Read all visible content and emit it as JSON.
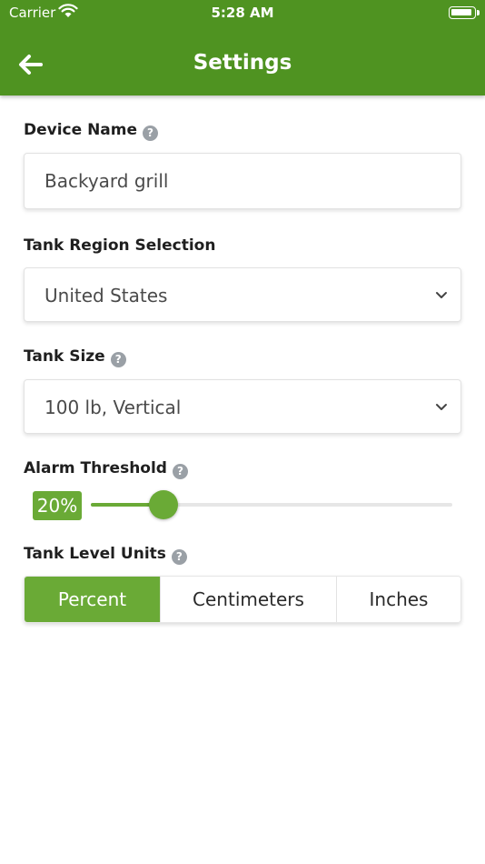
{
  "status_bar": {
    "carrier": "Carrier",
    "time": "5:28 AM"
  },
  "header": {
    "title": "Settings",
    "back_icon": "arrow-left-icon"
  },
  "colors": {
    "header": "#4f9321",
    "accent": "#6aaa36",
    "help_icon": "#9aa0a6"
  },
  "device_name": {
    "label": "Device Name",
    "value": "Backyard grill"
  },
  "tank_region": {
    "label": "Tank Region Selection",
    "selected": "United States"
  },
  "tank_size": {
    "label": "Tank Size",
    "selected": "100 lb, Vertical"
  },
  "alarm_threshold": {
    "label": "Alarm Threshold",
    "value_text": "20%",
    "value": 20,
    "min": 0,
    "max": 100
  },
  "tank_level_units": {
    "label": "Tank Level Units",
    "options": [
      "Percent",
      "Centimeters",
      "Inches"
    ],
    "selected": "Percent"
  }
}
